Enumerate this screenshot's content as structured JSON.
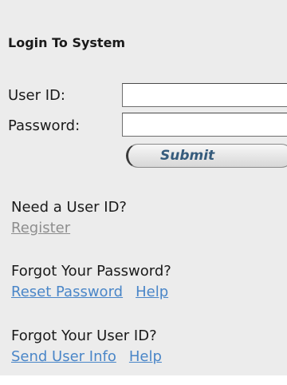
{
  "login": {
    "title": "Login To System",
    "user_id_label": "User ID:",
    "password_label": "Password:",
    "user_id_value": "",
    "password_value": "",
    "submit_label": "Submit"
  },
  "help": {
    "register_question": "Need a User ID?",
    "register_link": "Register",
    "forgot_password_question": "Forgot Your Password?",
    "reset_password_link": "Reset Password",
    "password_help_link": "Help",
    "forgot_userid_question": "Forgot Your User ID?",
    "send_user_info_link": "Send User Info",
    "userid_help_link": "Help"
  },
  "colors": {
    "panel_background": "#ececec",
    "link_blue": "#4a86c8",
    "link_muted": "#8e8e8e",
    "submit_text": "#355b7c"
  }
}
